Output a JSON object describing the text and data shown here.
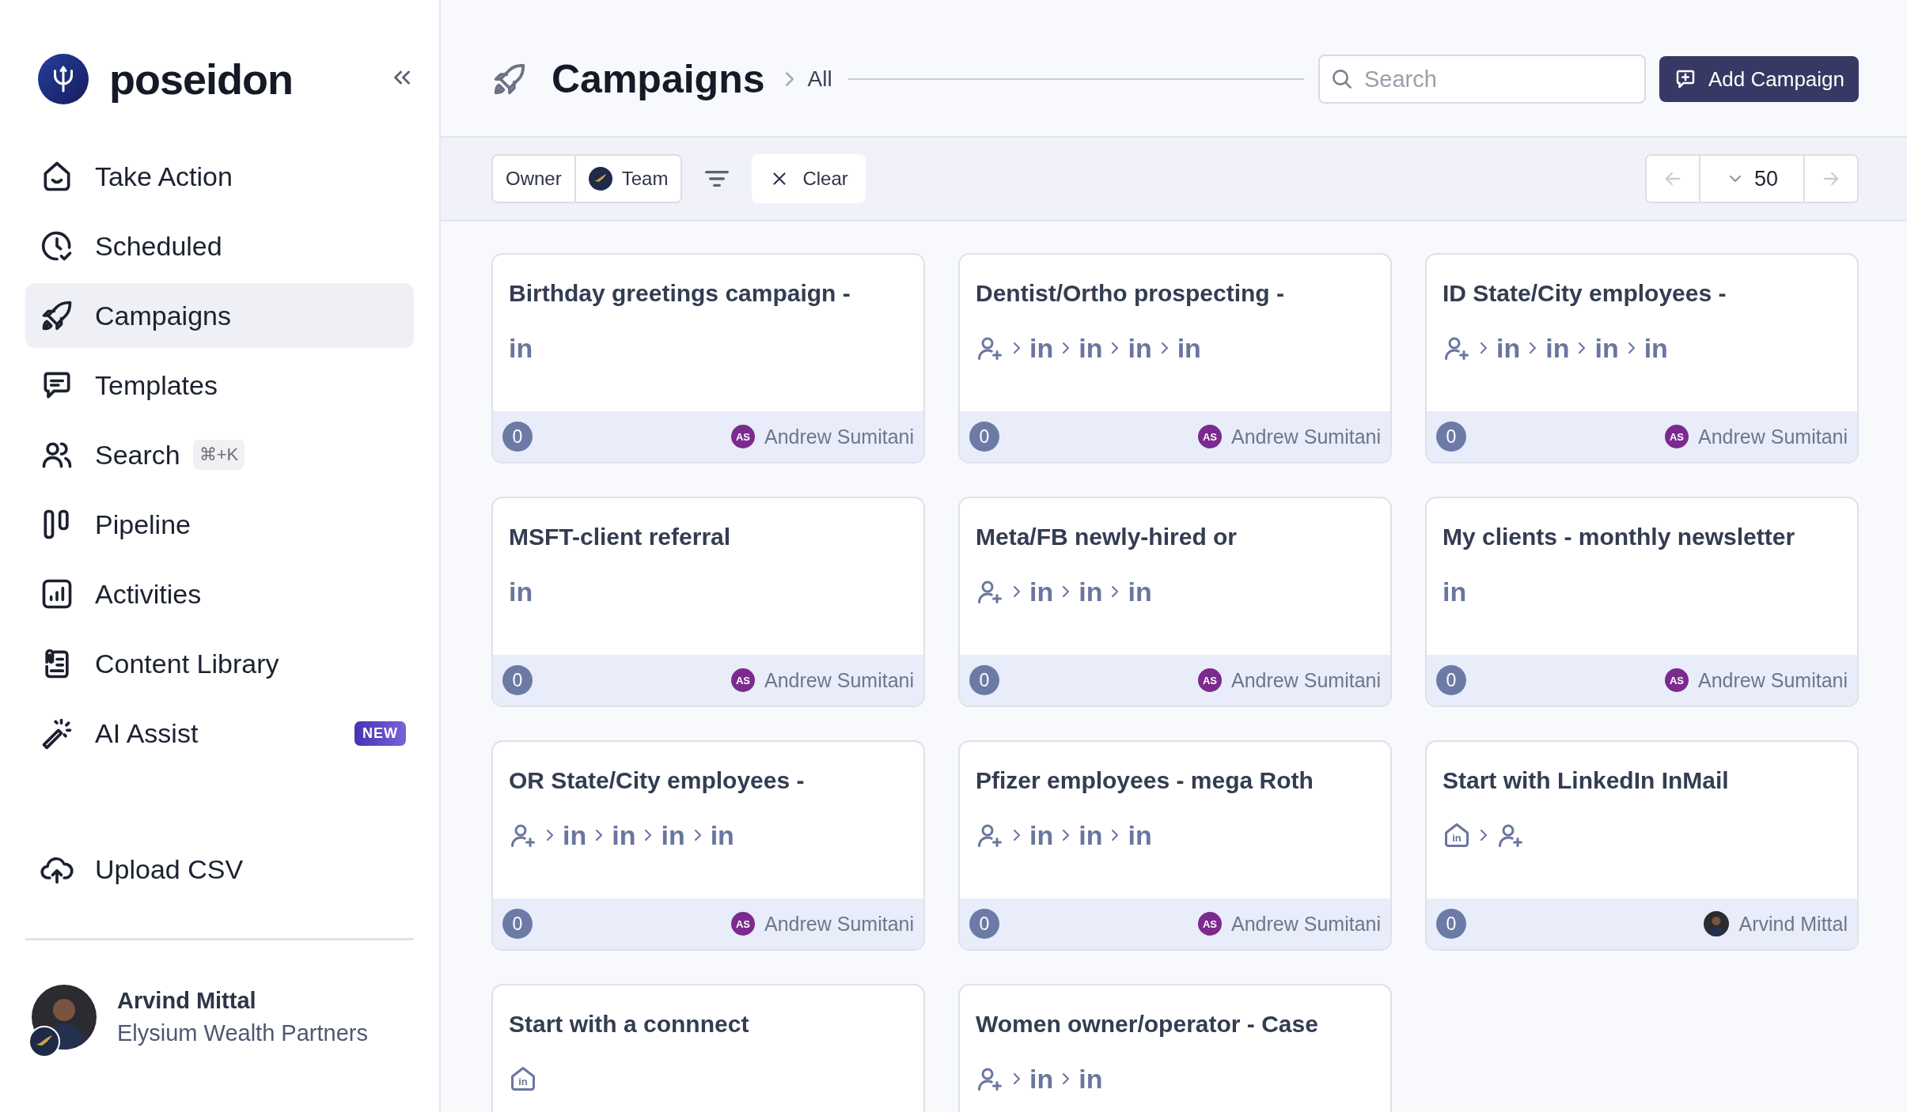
{
  "sidebar": {
    "brand": "poseidon",
    "items": [
      {
        "label": "Take Action",
        "selected": false
      },
      {
        "label": "Scheduled",
        "selected": false
      },
      {
        "label": "Campaigns",
        "selected": true
      },
      {
        "label": "Templates",
        "selected": false
      },
      {
        "label": "Search",
        "shortcut": "⌘+K",
        "selected": false
      },
      {
        "label": "Pipeline",
        "selected": false
      },
      {
        "label": "Activities",
        "selected": false
      },
      {
        "label": "Content Library",
        "selected": false
      },
      {
        "label": "AI Assist",
        "badge": "NEW",
        "selected": false
      }
    ],
    "upload": "Upload CSV",
    "user": {
      "name": "Arvind Mittal",
      "org": "Elysium Wealth Partners"
    }
  },
  "header": {
    "title": "Campaigns",
    "breadcrumb": "All",
    "search": {
      "placeholder": "Search"
    },
    "add_button": "Add Campaign"
  },
  "filters": {
    "owner": "Owner",
    "team": "Team",
    "clear": "Clear",
    "pagination": {
      "page_size": "50",
      "previous_disabled": true,
      "next_disabled": true
    }
  },
  "campaigns": [
    {
      "title": "Birthday greetings campaign -",
      "steps": [
        {
          "kind": "linkedin",
          "label": "in"
        }
      ],
      "count": "0",
      "owner": {
        "kind": "initials",
        "initials": "AS",
        "name": "Andrew Sumitani"
      }
    },
    {
      "title": "Dentist/Ortho prospecting -",
      "steps": [
        {
          "kind": "connect"
        },
        {
          "kind": "linkedin",
          "label": "in"
        },
        {
          "kind": "linkedin",
          "label": "in"
        },
        {
          "kind": "linkedin",
          "label": "in"
        },
        {
          "kind": "linkedin",
          "label": "in"
        }
      ],
      "count": "0",
      "owner": {
        "kind": "initials",
        "initials": "AS",
        "name": "Andrew Sumitani"
      }
    },
    {
      "title": "ID State/City employees -",
      "steps": [
        {
          "kind": "connect"
        },
        {
          "kind": "linkedin",
          "label": "in"
        },
        {
          "kind": "linkedin",
          "label": "in"
        },
        {
          "kind": "linkedin",
          "label": "in"
        },
        {
          "kind": "linkedin",
          "label": "in"
        }
      ],
      "count": "0",
      "owner": {
        "kind": "initials",
        "initials": "AS",
        "name": "Andrew Sumitani"
      }
    },
    {
      "title": "MSFT-client referral",
      "steps": [
        {
          "kind": "linkedin",
          "label": "in"
        }
      ],
      "count": "0",
      "owner": {
        "kind": "initials",
        "initials": "AS",
        "name": "Andrew Sumitani"
      }
    },
    {
      "title": "Meta/FB newly-hired or",
      "steps": [
        {
          "kind": "connect"
        },
        {
          "kind": "linkedin",
          "label": "in"
        },
        {
          "kind": "linkedin",
          "label": "in"
        },
        {
          "kind": "linkedin",
          "label": "in"
        }
      ],
      "count": "0",
      "owner": {
        "kind": "initials",
        "initials": "AS",
        "name": "Andrew Sumitani"
      }
    },
    {
      "title": "My clients - monthly newsletter",
      "steps": [
        {
          "kind": "linkedin",
          "label": "in"
        }
      ],
      "count": "0",
      "owner": {
        "kind": "initials",
        "initials": "AS",
        "name": "Andrew Sumitani"
      }
    },
    {
      "title": "OR State/City employees -",
      "steps": [
        {
          "kind": "connect"
        },
        {
          "kind": "linkedin",
          "label": "in"
        },
        {
          "kind": "linkedin",
          "label": "in"
        },
        {
          "kind": "linkedin",
          "label": "in"
        },
        {
          "kind": "linkedin",
          "label": "in"
        }
      ],
      "count": "0",
      "owner": {
        "kind": "initials",
        "initials": "AS",
        "name": "Andrew Sumitani"
      }
    },
    {
      "title": "Pfizer employees - mega Roth",
      "steps": [
        {
          "kind": "connect"
        },
        {
          "kind": "linkedin",
          "label": "in"
        },
        {
          "kind": "linkedin",
          "label": "in"
        },
        {
          "kind": "linkedin",
          "label": "in"
        }
      ],
      "count": "0",
      "owner": {
        "kind": "initials",
        "initials": "AS",
        "name": "Andrew Sumitani"
      }
    },
    {
      "title": "Start with LinkedIn InMail",
      "steps": [
        {
          "kind": "inmail",
          "label": "in"
        },
        {
          "kind": "connect"
        }
      ],
      "count": "0",
      "owner": {
        "kind": "photo",
        "name": "Arvind Mittal"
      }
    },
    {
      "title": "Start with a connnect",
      "steps": [
        {
          "kind": "inmail",
          "label": "in"
        }
      ]
    },
    {
      "title": "Women owner/operator - Case",
      "steps": [
        {
          "kind": "connect"
        },
        {
          "kind": "linkedin",
          "label": "in"
        },
        {
          "kind": "linkedin",
          "label": "in"
        }
      ]
    }
  ]
}
